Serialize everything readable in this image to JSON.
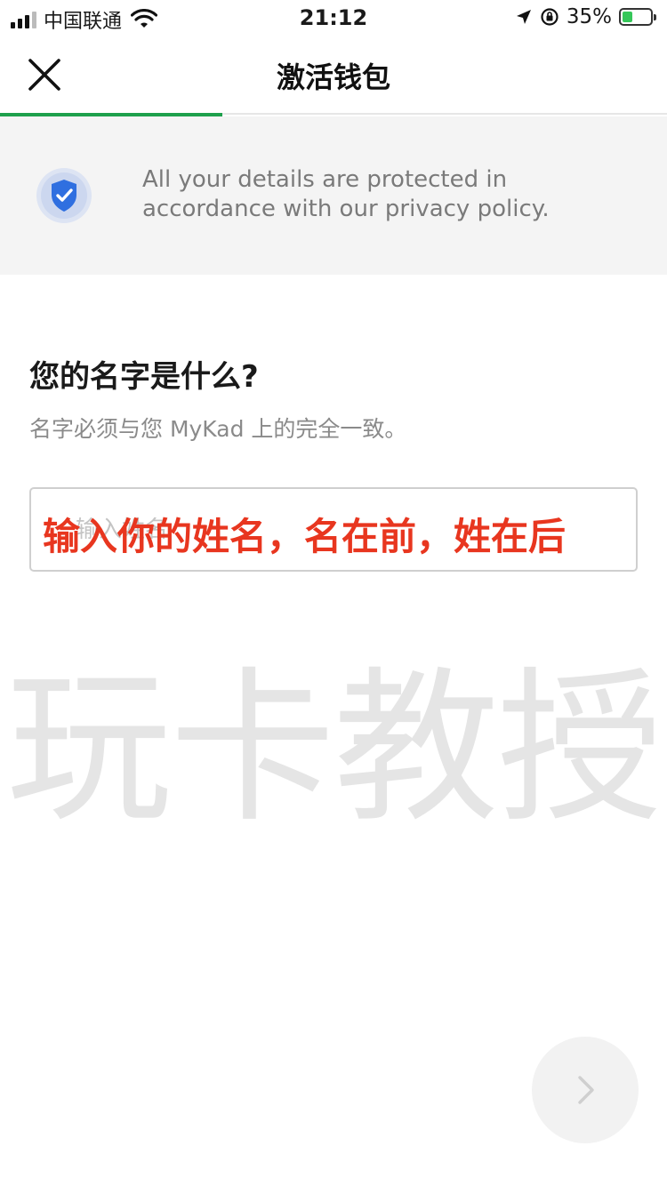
{
  "status_bar": {
    "carrier": "中国联通",
    "time": "21:12",
    "battery_percent": "35%",
    "battery_level": 0.35
  },
  "nav": {
    "title": "激活钱包",
    "close_icon": "close-icon",
    "progress": 0.333
  },
  "privacy": {
    "icon": "shield-check-icon",
    "text": "All your details are protected in accordance with our privacy policy."
  },
  "question": {
    "title": "您的名字是什么?",
    "hint": "名字必须与您 MyKad 上的完全一致。"
  },
  "name_input": {
    "placeholder": "输入姓名",
    "value": ""
  },
  "annotation": {
    "text": "输入你的姓名，名在前，姓在后"
  },
  "watermark": {
    "text": "玩卡教授"
  },
  "next_button": {
    "icon": "chevron-right-icon"
  },
  "colors": {
    "accent_green": "#1ea04c",
    "annotation_red": "#e8361f",
    "shield_blue": "#2f6fe0",
    "banner_bg": "#f4f4f4"
  }
}
